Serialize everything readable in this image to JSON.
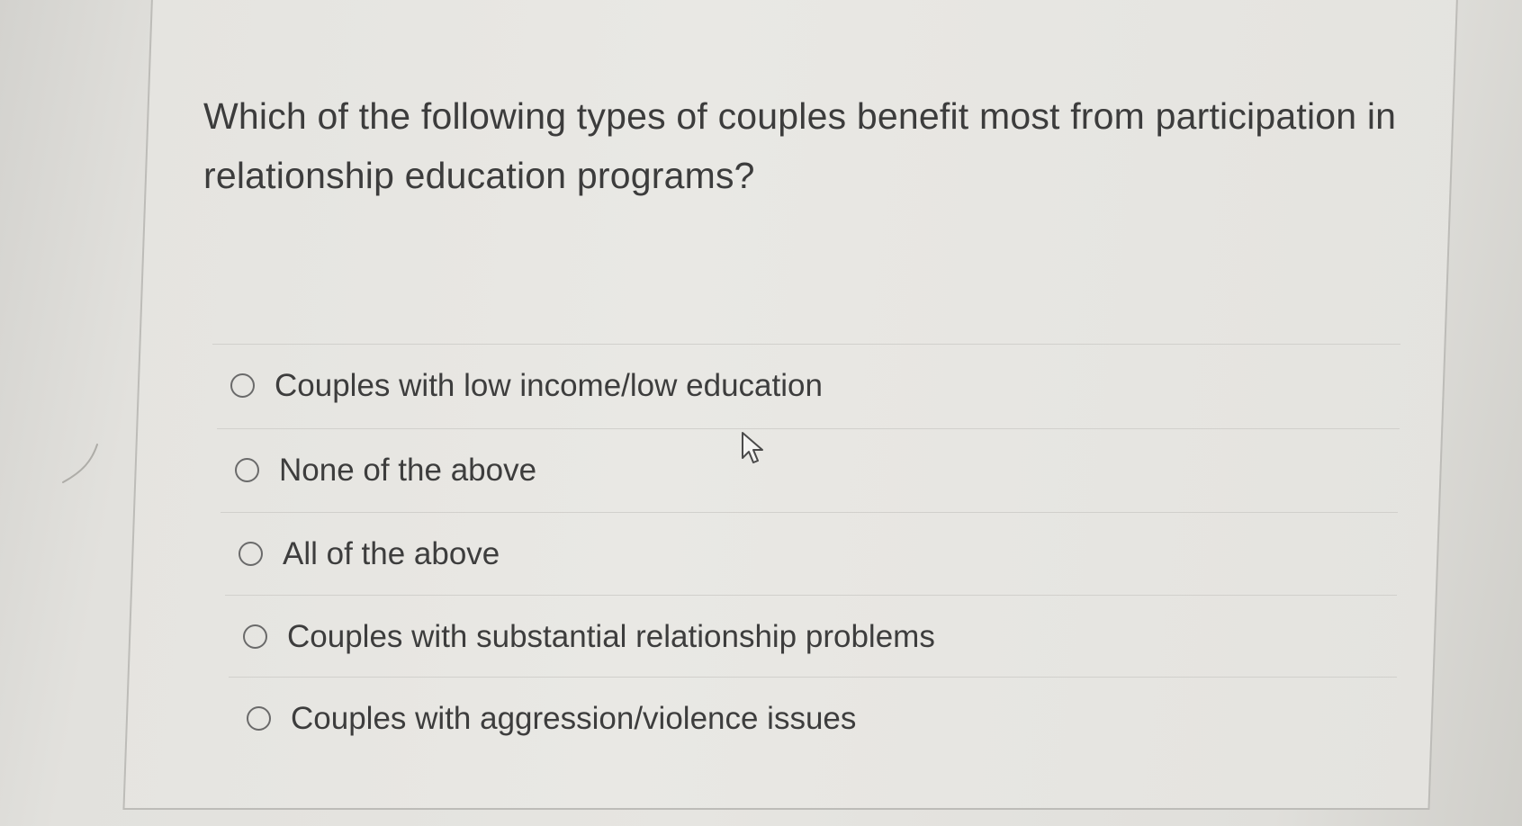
{
  "question": {
    "text": "Which of the following types of couples benefit most from participation in relationship education programs?"
  },
  "options": [
    {
      "label": "Couples with low income/low education",
      "selected": false
    },
    {
      "label": "None of the above",
      "selected": false
    },
    {
      "label": "All of the above",
      "selected": false
    },
    {
      "label": "Couples with substantial relationship problems",
      "selected": false
    },
    {
      "label": "Couples with aggression/violence issues",
      "selected": false
    }
  ],
  "icons": {
    "cursor": "mouse-pointer-icon",
    "radio": "radio-button-icon"
  },
  "colors": {
    "text": "#3c3c3c",
    "panel_border": "#bdbcb8",
    "divider": "#d1d0cc"
  }
}
